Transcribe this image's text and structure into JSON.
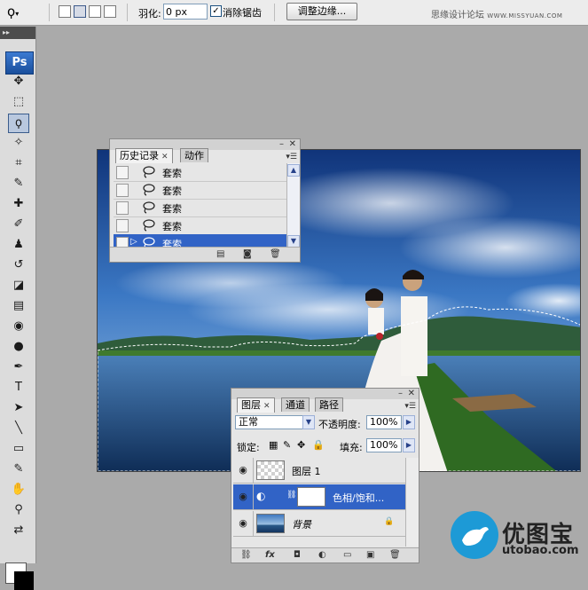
{
  "options_bar": {
    "feather_label": "羽化:",
    "feather_value": "0 px",
    "antialias_label": "消除锯齿",
    "antialias_checked": true,
    "refine_edge_label": "调整边缘...",
    "site_text": "思缘设计论坛",
    "site_url": "WWW.MISSYUAN.COM"
  },
  "toolbox": {
    "logo": "Ps",
    "grip": "▸▸",
    "tools": [
      {
        "name": "move-tool",
        "glyph": "✥"
      },
      {
        "name": "marquee-tool",
        "glyph": "⬚"
      },
      {
        "name": "lasso-tool",
        "glyph": "ϙ",
        "active": true
      },
      {
        "name": "magic-wand-tool",
        "glyph": "✧"
      },
      {
        "name": "crop-tool",
        "glyph": "⌗"
      },
      {
        "name": "eyedropper-tool",
        "glyph": "✎"
      },
      {
        "name": "healing-brush-tool",
        "glyph": "✚"
      },
      {
        "name": "brush-tool",
        "glyph": "✐"
      },
      {
        "name": "clone-stamp-tool",
        "glyph": "♟"
      },
      {
        "name": "history-brush-tool",
        "glyph": "↺"
      },
      {
        "name": "eraser-tool",
        "glyph": "◪"
      },
      {
        "name": "gradient-tool",
        "glyph": "▤"
      },
      {
        "name": "blur-tool",
        "glyph": "◉"
      },
      {
        "name": "dodge-tool",
        "glyph": "●"
      },
      {
        "name": "pen-tool",
        "glyph": "✒"
      },
      {
        "name": "type-tool",
        "glyph": "T"
      },
      {
        "name": "path-selection-tool",
        "glyph": "➤"
      },
      {
        "name": "line-tool",
        "glyph": "╲"
      },
      {
        "name": "notes-tool",
        "glyph": "▭"
      },
      {
        "name": "eyedropper-sample-tool",
        "glyph": "✎"
      },
      {
        "name": "hand-tool",
        "glyph": "✋"
      },
      {
        "name": "zoom-tool",
        "glyph": "⚲"
      },
      {
        "name": "swap-colors-tool",
        "glyph": "⇄"
      }
    ]
  },
  "history_panel": {
    "tabs": [
      "历史记录",
      "动作"
    ],
    "items": [
      {
        "label": "套索",
        "selected": false
      },
      {
        "label": "套索",
        "selected": false
      },
      {
        "label": "套索",
        "selected": false
      },
      {
        "label": "套索",
        "selected": false
      },
      {
        "label": "套索",
        "selected": true
      }
    ]
  },
  "layers_panel": {
    "tabs": [
      "图层",
      "通道",
      "路径"
    ],
    "blend_mode": "正常",
    "opacity_label": "不透明度:",
    "opacity_value": "100%",
    "lock_label": "锁定:",
    "fill_label": "填充:",
    "fill_value": "100%",
    "layers": [
      {
        "name": "图层 1",
        "selected": false,
        "type": "transparent"
      },
      {
        "name": "色相/饱和...",
        "selected": true,
        "type": "adjustment"
      },
      {
        "name": "背景",
        "selected": false,
        "type": "background"
      }
    ]
  },
  "watermark": {
    "name": "优图宝",
    "url": "utobao.com"
  },
  "colors": {
    "selection_blue": "#3163c6",
    "panel_bg": "#e6e6e6",
    "workspace": "#aaaaaa"
  }
}
